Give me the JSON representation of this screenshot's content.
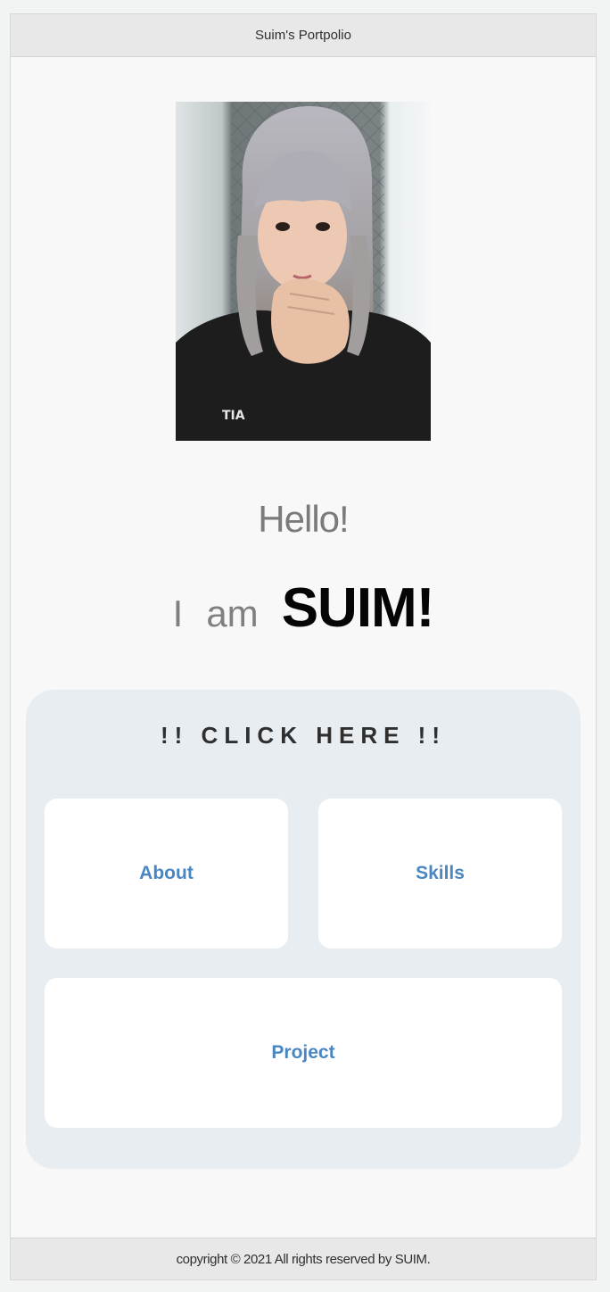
{
  "header": {
    "title": "Suim's Portpolio"
  },
  "hero": {
    "photo_name": "profile-photo",
    "hello": "Hello!",
    "i_word": "I",
    "am_word": "am",
    "name": "SUIM!"
  },
  "menu": {
    "title": "!! CLICK HERE !!",
    "about_label": "About",
    "skills_label": "Skills",
    "project_label": "Project"
  },
  "footer": {
    "text": "copyright © 2021 All rights reserved by SUIM."
  },
  "colors": {
    "accent_link": "#4a86c2",
    "panel_bg": "#e7edf1",
    "bar_bg": "#e8e8e8"
  }
}
